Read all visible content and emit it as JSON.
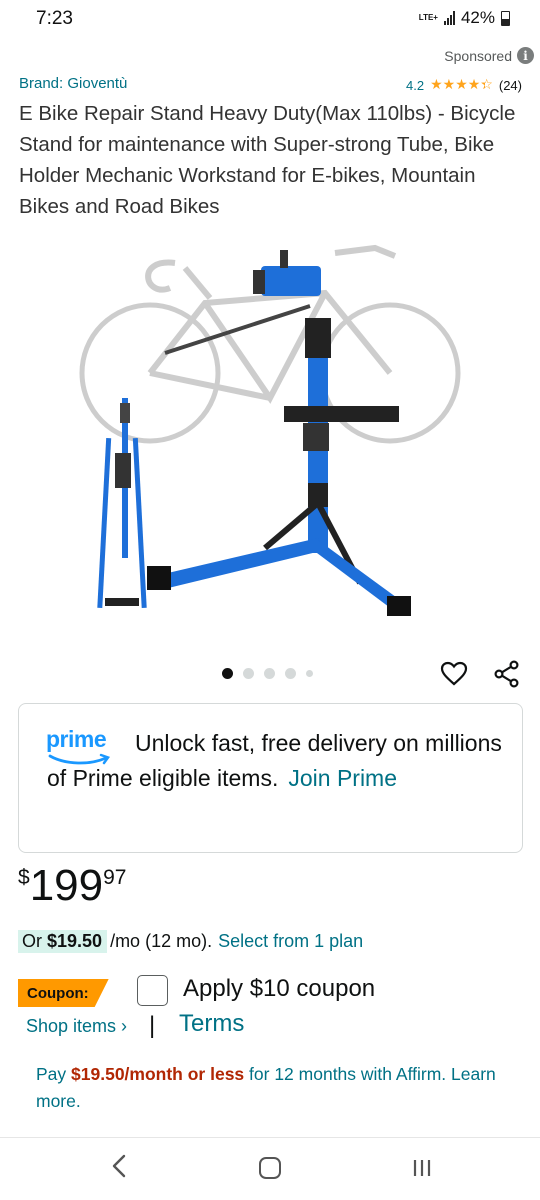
{
  "status_bar": {
    "time": "7:23",
    "network": "LTE+",
    "battery": "42%"
  },
  "sponsored": {
    "label": "Sponsored",
    "icon": "info-icon"
  },
  "product": {
    "brand": "Brand: Gioventù",
    "rating": "4.2",
    "rating_stars": 4.2,
    "rating_count": "(24)",
    "title": "E Bike Repair Stand Heavy Duty(Max 110lbs) - Bicycle Stand for maintenance with Super-strong Tube, Bike Holder Mechanic Workstand for E-bikes, Mountain Bikes and Road Bikes"
  },
  "gallery": {
    "image_count": 5,
    "active_index": 0,
    "actions": [
      "heart-icon",
      "share-icon"
    ]
  },
  "prime": {
    "logo_text": "prime",
    "message": "Unlock fast, free delivery on millions of Prime eligible items.",
    "cta": "Join Prime"
  },
  "price": {
    "symbol": "$",
    "whole": "199",
    "fraction": "97"
  },
  "installment": {
    "prefix": "Or ",
    "amount": "$19.50",
    "suffix": "/mo (12 mo).",
    "link": "Select from 1 plan"
  },
  "coupon": {
    "badge": "Coupon:",
    "label": "Apply $10 coupon",
    "checked": false,
    "shop_items": "Shop items ›",
    "separator": "|",
    "terms": "Terms"
  },
  "affirm": {
    "prefix": "Pay ",
    "amount": "$19.50/month or less",
    "suffix": " for 12 months with Affirm. Learn more."
  },
  "nav": {
    "icons": [
      "back-icon",
      "home-icon",
      "recents-icon"
    ]
  },
  "colors": {
    "link": "#007185",
    "prime_blue": "#1a98ff",
    "coupon_orange": "#ff9900",
    "star": "#ffa41c",
    "deal_red": "#b12704",
    "installment_bg": "#d8f3ec"
  }
}
